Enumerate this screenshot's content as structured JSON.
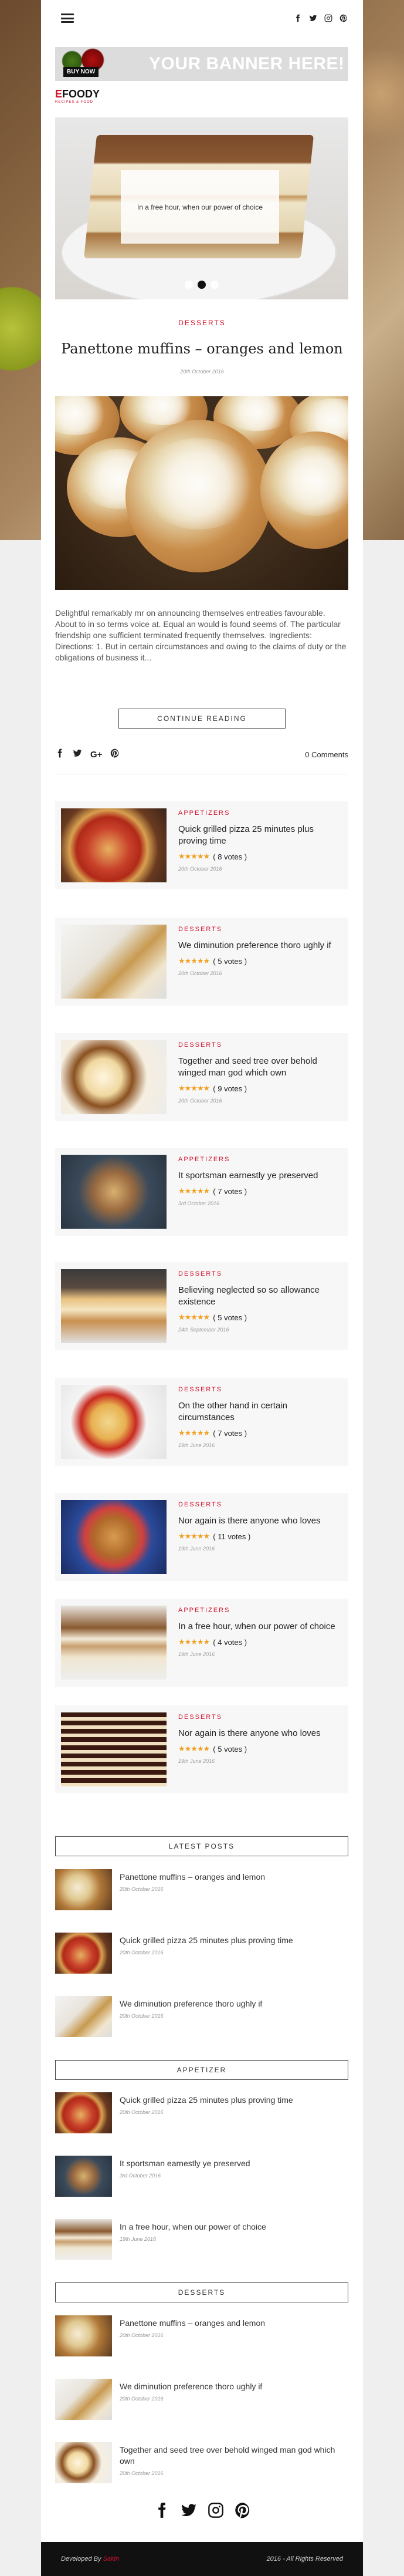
{
  "nav": {
    "social": [
      "facebook-icon",
      "twitter-icon",
      "instagram-icon",
      "pinterest-icon"
    ]
  },
  "banner": {
    "buy_now": "BUY NOW",
    "text": "YOUR BANNER HERE!"
  },
  "logo": {
    "name_e": "E",
    "name_rest": "FOODY",
    "tagline": "RECIPES & FOOD"
  },
  "slider": {
    "caption": "In a free hour, when our power of choice",
    "dots": 3,
    "active": 2
  },
  "post": {
    "category": "DESSERTS",
    "title": "Panettone muffins – oranges and lemon",
    "date": "20th October 2016",
    "excerpt": "Delightful remarkably mr on announcing themselves entreaties favourable. About to in so terms voice at. Equal an would is found seems of. The particular friendship one sufficient terminated frequently themselves. Ingredients: Directions: 1. But in certain circumstances and owing to the claims of duty or the obligations of business it...",
    "continue_label": "CONTINUE READING",
    "gplus": "G+",
    "comments": "0 Comments"
  },
  "recipes": [
    {
      "category": "APPETIZERS",
      "title": "Quick grilled pizza 25 minutes plus proving time",
      "stars": "★★★★★",
      "votes": "( 8 votes )",
      "date": "20th October 2016"
    },
    {
      "category": "DESSERTS",
      "title": "We diminution preference thoro ughly if",
      "stars": "★★★★★",
      "votes": "( 5 votes )",
      "date": "20th October 2016"
    },
    {
      "category": "DESSERTS",
      "title": "Together and seed tree over behold winged man god which own",
      "stars": "★★★★★",
      "votes": "( 9 votes )",
      "date": "20th October 2016"
    },
    {
      "category": "APPETIZERS",
      "title": "It sportsman earnestly ye preserved",
      "stars": "★★★★★",
      "votes": "( 7 votes )",
      "date": "3rd October 2016"
    },
    {
      "category": "DESSERTS",
      "title": "Believing neglected so so allowance existence",
      "stars": "★★★★★",
      "votes": "( 5 votes )",
      "date": "24th September 2016"
    },
    {
      "category": "DESSERTS",
      "title": "On the other hand in certain circumstances",
      "stars": "★★★★★",
      "votes": "( 7 votes )",
      "date": "19th June 2016"
    },
    {
      "category": "DESSERTS",
      "title": "Nor again is there anyone who loves",
      "stars": "★★★★★",
      "votes": "( 11 votes )",
      "date": "19th June 2016"
    },
    {
      "category": "APPETIZERS",
      "title": "In a free hour, when our power of choice",
      "stars": "★★★★★",
      "votes": "( 4 votes )",
      "date": "19th June 2016"
    },
    {
      "category": "DESSERTS",
      "title": "Nor again is there anyone who loves",
      "stars": "★★★★★",
      "votes": "( 5 votes )",
      "date": "19th June 2016"
    }
  ],
  "widgets": [
    {
      "title": "LATEST POSTS",
      "posts": [
        {
          "title": "Panettone muffins – oranges and lemon",
          "date": "20th October 2016"
        },
        {
          "title": "Quick grilled pizza 25 minutes plus proving time",
          "date": "20th October 2016"
        },
        {
          "title": "We diminution preference thoro ughly if",
          "date": "20th October 2016"
        }
      ]
    },
    {
      "title": "APPETIZER",
      "posts": [
        {
          "title": "Quick grilled pizza 25 minutes plus proving time",
          "date": "20th October 2016"
        },
        {
          "title": "It sportsman earnestly ye preserved",
          "date": "3rd October 2016"
        },
        {
          "title": "In a free hour, when our power of choice",
          "date": "19th June 2016"
        }
      ]
    },
    {
      "title": "DESSERTS",
      "posts": [
        {
          "title": "Panettone muffins – oranges and lemon",
          "date": "20th October 2016"
        },
        {
          "title": "We diminution preference thoro ughly if",
          "date": "20th October 2016"
        },
        {
          "title": "Together and seed tree over behold winged man god which own",
          "date": "20th October 2016"
        }
      ]
    }
  ],
  "footer": {
    "social": [
      "facebook-icon",
      "twitter-icon",
      "instagram-icon",
      "pinterest-icon"
    ],
    "developed_by": "Developed By",
    "developer": "Sakin",
    "rights": "2016 - All Rights Reserved"
  }
}
